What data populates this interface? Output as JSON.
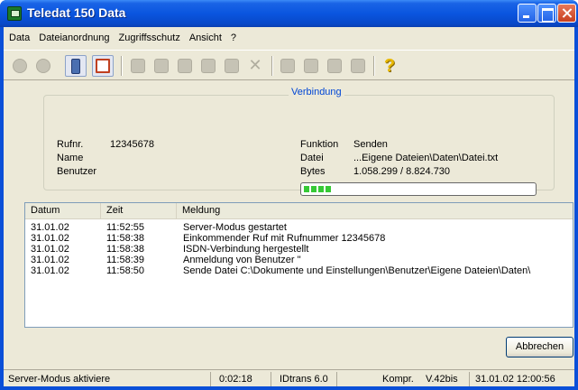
{
  "window": {
    "title": "Teledat 150 Data"
  },
  "menu": [
    "Data",
    "Dateianordnung",
    "Zugriffsschutz",
    "Ansicht",
    "?"
  ],
  "toolbar": {
    "icons": [
      "connect-icon",
      "disconnect-icon",
      "user-icon",
      "monitor-icon",
      "transfer-icon",
      "copy-icon",
      "move-icon",
      "new-folder-icon",
      "rename-icon",
      "delete-icon",
      "copy-all-icon",
      "copy-selected-icon",
      "move-all-icon",
      "move-selected-icon",
      "help-icon"
    ]
  },
  "connection": {
    "legend": "Verbindung",
    "rufnr_label": "Rufnr.",
    "rufnr_value": "12345678",
    "name_label": "Name",
    "benutzer_label": "Benutzer",
    "funktion_label": "Funktion",
    "funktion_value": "Senden",
    "datei_label": "Datei",
    "datei_value": "...Eigene Dateien\\Daten\\Datei.txt",
    "bytes_label": "Bytes",
    "bytes_value": "1.058.299 / 8.824.730",
    "progress_fraction": 0.12
  },
  "log": {
    "columns": [
      "Datum",
      "Zeit",
      "Meldung"
    ],
    "rows": [
      {
        "datum": "31.01.02",
        "zeit": "11:52:55",
        "meldung": "Server-Modus gestartet"
      },
      {
        "datum": "31.01.02",
        "zeit": "11:58:38",
        "meldung": "Einkommender Ruf mit Rufnummer 12345678"
      },
      {
        "datum": "31.01.02",
        "zeit": "11:58:38",
        "meldung": "ISDN-Verbindung hergestellt"
      },
      {
        "datum": "31.01.02",
        "zeit": "11:58:39",
        "meldung": "Anmeldung von Benutzer ''"
      },
      {
        "datum": "31.01.02",
        "zeit": "11:58:50",
        "meldung": "Sende Datei C:\\Dokumente und Einstellungen\\Benutzer\\Eigene Dateien\\Daten\\"
      }
    ]
  },
  "buttons": {
    "abbrechen": "Abbrechen"
  },
  "status": {
    "mode": "Server-Modus aktiviere",
    "elapsed": "0:02:18",
    "protocol": "IDtrans 6.0",
    "compression": "Kompr.",
    "standard": "V.42bis",
    "datetime": "31.01.02 12:00:56"
  },
  "colors": {
    "titlebar": "#0a55df",
    "legend": "#0046d5",
    "progress": "#37c936"
  }
}
